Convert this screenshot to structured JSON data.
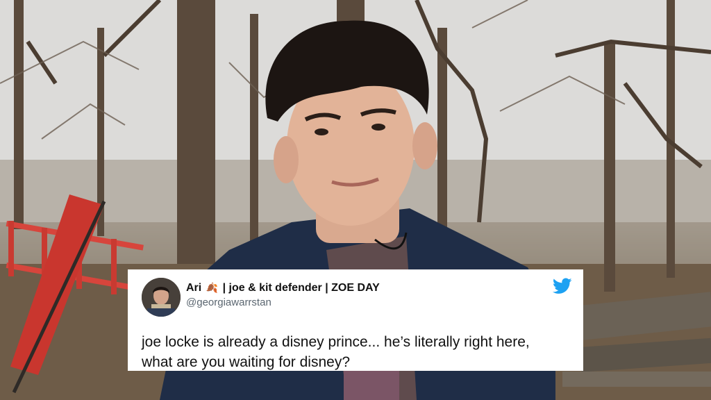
{
  "tweet": {
    "display_name_part1": "Ari",
    "display_name_emoji": "🍂",
    "display_name_part2": "| joe & kit defender | ZOE DAY",
    "handle": "@georgiawarrstan",
    "text_line1": "joe locke is already a disney prince... he’s literally right here,",
    "text_line2": "what are you waiting for disney?",
    "brand_color": "#1da1f2"
  },
  "icons": [
    "twitter-bird-icon",
    "leaf-emoji-icon"
  ],
  "colors": {
    "card": "#ffffff",
    "name_text": "#111111",
    "handle_text": "#5b6670"
  }
}
